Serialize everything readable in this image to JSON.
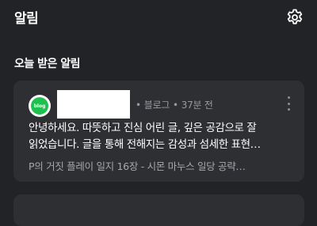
{
  "header": {
    "title": "알림"
  },
  "section": {
    "title": "오늘 받은 알림"
  },
  "notification": {
    "avatar_label": "blog",
    "source": "블로그",
    "time": "37분 전",
    "message_line1": "안녕하세요. 따뜻하고 진심 어린 글, 깊은 공감으로 잘",
    "message_line2": "읽었습니다. 글을 통해 전해지는 감성과 섬세한 표현…",
    "post_title": "P의 거짓 플레이 일지 16장 - 시몬 마누스 일당 공략…"
  },
  "colors": {
    "background": "#222327",
    "card": "#2e2f33",
    "brand": "#1fc14e"
  }
}
